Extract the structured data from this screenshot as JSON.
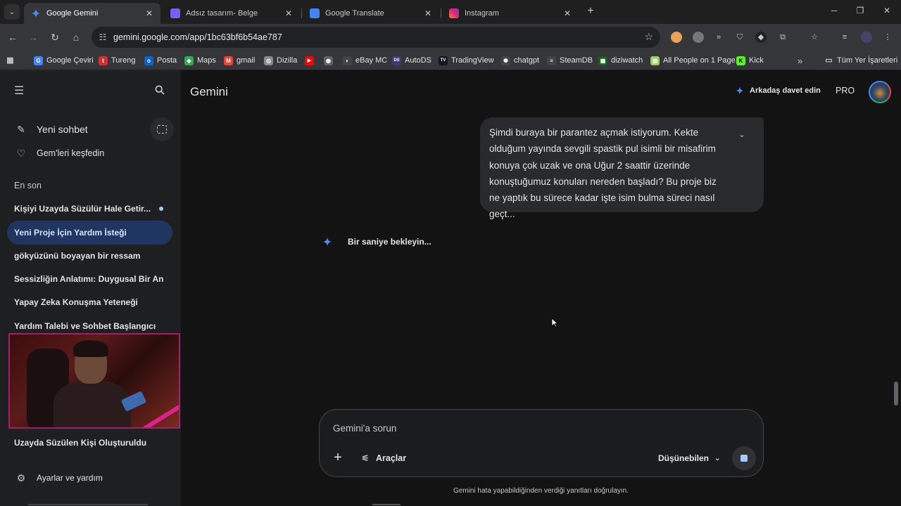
{
  "browser": {
    "tabs": [
      {
        "title": "Google Gemini",
        "active": true,
        "favicon_color": "#4a8cf7"
      },
      {
        "title": "Adsız tasarım- Belge",
        "active": false,
        "favicon_color": "#7d5cf5"
      },
      {
        "title": "Google Translate",
        "active": false,
        "favicon_color": "#4285f4"
      },
      {
        "title": "Instagram",
        "active": false,
        "favicon_color": "#e1306c"
      }
    ],
    "url": "gemini.google.com/app/1bc63bf6b54ae787",
    "bookmarks": [
      {
        "label": "Google Çeviri",
        "icon": "G",
        "color": "#4285f4"
      },
      {
        "label": "Tureng",
        "icon": "t",
        "color": "#d32f2f"
      },
      {
        "label": "Posta",
        "icon": "o",
        "color": "#0a64d6"
      },
      {
        "label": "Maps",
        "icon": "◆",
        "color": "#34a853"
      },
      {
        "label": "gmail",
        "icon": "M",
        "color": "#ea4335"
      },
      {
        "label": "Dizilla",
        "icon": "◎",
        "color": "#888888"
      },
      {
        "label": "",
        "icon": "▶",
        "color": "#ff0000"
      },
      {
        "label": "",
        "icon": "◉",
        "color": "#5f6368"
      },
      {
        "label": "eBay MC",
        "icon": "◐",
        "color": "#444444"
      },
      {
        "label": "AutoDS",
        "icon": "DS",
        "color": "#3b3b7a"
      },
      {
        "label": "TradingView",
        "icon": "TV",
        "color": "#131722"
      },
      {
        "label": "chatgpt",
        "icon": "✺",
        "color": "#444444"
      },
      {
        "label": "SteamDB",
        "icon": "≡",
        "color": "#444444"
      },
      {
        "label": "diziwatch",
        "icon": "▦",
        "color": "#1b5e20"
      },
      {
        "label": "All People on 1 Page",
        "icon": "▥",
        "color": "#9ccc65"
      },
      {
        "label": "Kick",
        "icon": "K",
        "color": "#53fc18"
      }
    ],
    "all_bookmarks_label": "Tüm Yer İşaretleri"
  },
  "sidebar": {
    "new_chat": "Yeni sohbet",
    "explore_gems": "Gem'leri keşfedin",
    "recent_title": "En son",
    "chats": [
      {
        "title": "Kişiyi Uzayda Süzülür Hale Getir...",
        "selected": false
      },
      {
        "title": "Yeni Proje İçin Yardım İsteği",
        "selected": true
      },
      {
        "title": "gökyüzünü boyayan bir ressam",
        "selected": false
      },
      {
        "title": "Sessizliğin Anlatımı: Duygusal Bir An",
        "selected": false
      },
      {
        "title": "Yapay Zeka Konuşma Yeteneği",
        "selected": false
      },
      {
        "title": "Yardım Talebi ve Sohbet Başlangıcı",
        "selected": false
      }
    ],
    "last_chat": "Uzayda Süzülen Kişi Oluşturuldu",
    "settings": "Ayarlar ve yardım"
  },
  "header": {
    "brand": "Gemini",
    "invite": "Arkadaş davet edin",
    "plan": "PRO"
  },
  "conversation": {
    "user_message": "Şimdi buraya bir parantez açmak istiyorum. Kekte olduğum yayında sevgili spastik pul isimli bir misafirim konuya çok uzak ve ona Uğur 2 saattir üzerinde konuştuğumuz konuları nereden başladı? Bu proje biz ne yaptık bu sürece kadar işte isim bulma süreci nasıl geçt...",
    "status": "Bir saniye bekleyin..."
  },
  "composer": {
    "placeholder": "Gemini'a sorun",
    "tools_label": "Araçlar",
    "model_label": "Düşünebilen"
  },
  "disclaimer": "Gemini hata yapabildiğinden verdiği yanıtları doğrulayın."
}
